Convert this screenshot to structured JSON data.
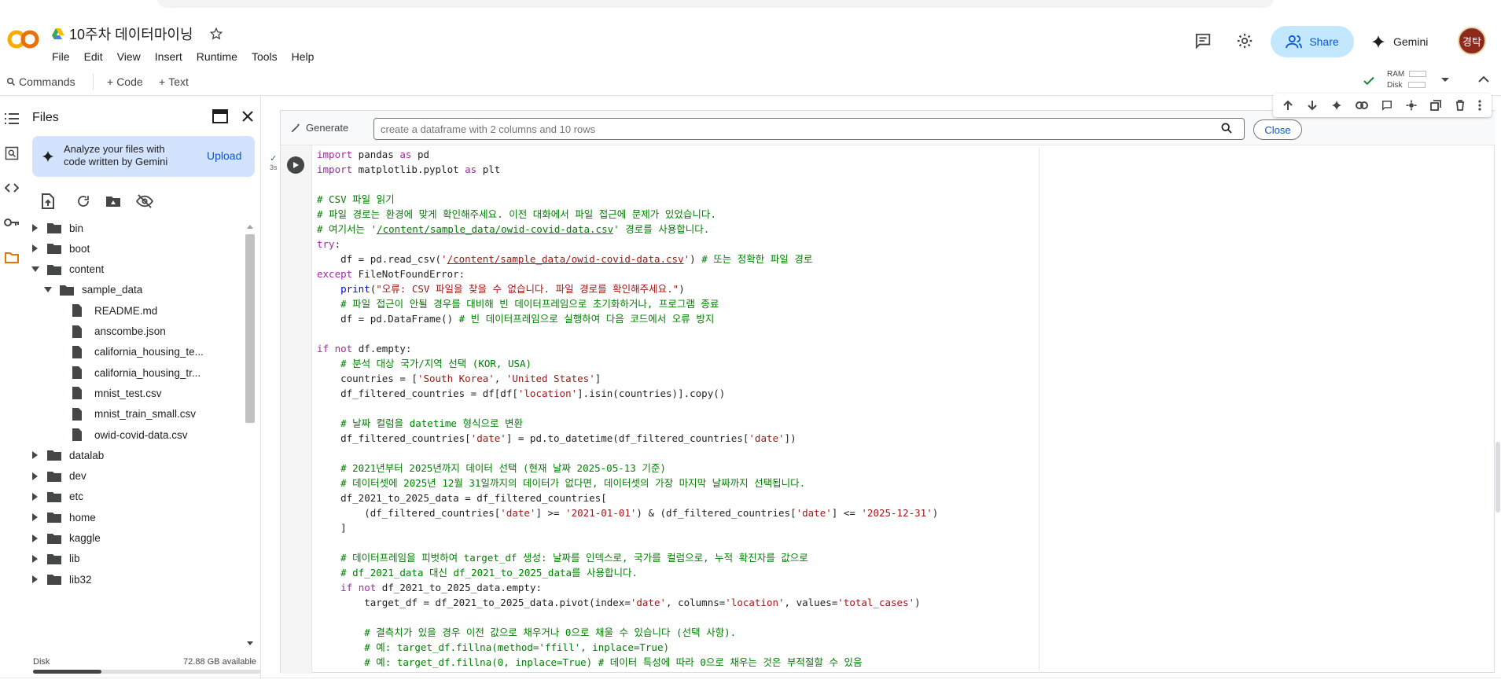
{
  "header": {
    "notebook_title": "10주차 데이터마이닝",
    "menu": [
      "File",
      "Edit",
      "View",
      "Insert",
      "Runtime",
      "Tools",
      "Help"
    ],
    "share_label": "Share",
    "gemini_label": "Gemini",
    "avatar_text": "경탁",
    "icons": [
      "comment-icon",
      "gear-icon",
      "share-people-icon",
      "sparkle-icon",
      "star-icon",
      "drive-icon"
    ]
  },
  "toolbar": {
    "commands_label": "Commands",
    "code_label": "Code",
    "text_label": "Text",
    "ram_label": "RAM",
    "disk_label": "Disk"
  },
  "files_panel": {
    "title": "Files",
    "analyze_text": "Analyze your files with code written by Gemini",
    "upload_label": "Upload",
    "tree": [
      {
        "name": "bin",
        "type": "folder",
        "depth": 0,
        "expanded": false
      },
      {
        "name": "boot",
        "type": "folder",
        "depth": 0,
        "expanded": false
      },
      {
        "name": "content",
        "type": "folder",
        "depth": 0,
        "expanded": true
      },
      {
        "name": "sample_data",
        "type": "folder",
        "depth": 1,
        "expanded": true
      },
      {
        "name": "README.md",
        "type": "file",
        "depth": 2
      },
      {
        "name": "anscombe.json",
        "type": "file",
        "depth": 2
      },
      {
        "name": "california_housing_te...",
        "type": "file",
        "depth": 2
      },
      {
        "name": "california_housing_tr...",
        "type": "file",
        "depth": 2
      },
      {
        "name": "mnist_test.csv",
        "type": "file",
        "depth": 2
      },
      {
        "name": "mnist_train_small.csv",
        "type": "file",
        "depth": 2
      },
      {
        "name": "owid-covid-data.csv",
        "type": "file",
        "depth": 2
      },
      {
        "name": "datalab",
        "type": "folder",
        "depth": 0,
        "expanded": false
      },
      {
        "name": "dev",
        "type": "folder",
        "depth": 0,
        "expanded": false
      },
      {
        "name": "etc",
        "type": "folder",
        "depth": 0,
        "expanded": false
      },
      {
        "name": "home",
        "type": "folder",
        "depth": 0,
        "expanded": false
      },
      {
        "name": "kaggle",
        "type": "folder",
        "depth": 0,
        "expanded": false
      },
      {
        "name": "lib",
        "type": "folder",
        "depth": 0,
        "expanded": false
      },
      {
        "name": "lib32",
        "type": "folder",
        "depth": 0,
        "expanded": false
      }
    ],
    "disk_label": "Disk",
    "disk_available": "72.88 GB available",
    "disk_used_fraction": 0.3
  },
  "cell": {
    "generate_label": "Generate",
    "generate_placeholder": "create a dataframe with 2 columns and 10 rows",
    "close_label": "Close",
    "exec_check": "✓",
    "exec_time": "3s",
    "code_lines": [
      [
        {
          "t": "import",
          "c": "kw"
        },
        {
          "t": " pandas "
        },
        {
          "t": "as",
          "c": "kw"
        },
        {
          "t": " pd"
        }
      ],
      [
        {
          "t": "import",
          "c": "kw"
        },
        {
          "t": " matplotlib.pyplot "
        },
        {
          "t": "as",
          "c": "kw"
        },
        {
          "t": " plt"
        }
      ],
      [],
      [
        {
          "t": "# CSV 파일 읽기",
          "c": "cm"
        }
      ],
      [
        {
          "t": "# 파일 경로는 환경에 맞게 확인해주세요. 이전 대화에서 파일 접근에 문제가 있었습니다.",
          "c": "cm"
        }
      ],
      [
        {
          "t": "# 여기서는 '",
          "c": "cm"
        },
        {
          "t": "/content/sample_data/owid-covid-data.csv",
          "c": "cm lk"
        },
        {
          "t": "' 경로를 사용합니다.",
          "c": "cm"
        }
      ],
      [
        {
          "t": "try",
          "c": "kw"
        },
        {
          "t": ":"
        }
      ],
      [
        {
          "t": "    df = pd.read_csv("
        },
        {
          "t": "'",
          "c": "st"
        },
        {
          "t": "/content/sample_data/owid-covid-data.csv",
          "c": "st lk"
        },
        {
          "t": "'",
          "c": "st"
        },
        {
          "t": ") "
        },
        {
          "t": "# 또는 정확한 파일 경로",
          "c": "cm"
        }
      ],
      [
        {
          "t": "except",
          "c": "kw"
        },
        {
          "t": " FileNotFoundError:"
        }
      ],
      [
        {
          "t": "    "
        },
        {
          "t": "print",
          "c": "kw2"
        },
        {
          "t": "("
        },
        {
          "t": "\"오류: CSV 파일을 찾을 수 없습니다. 파일 경로를 확인해주세요.\"",
          "c": "st"
        },
        {
          "t": ")"
        }
      ],
      [
        {
          "t": "    "
        },
        {
          "t": "# 파일 접근이 안될 경우를 대비해 빈 데이터프레임으로 초기화하거나, 프로그램 종료",
          "c": "cm"
        }
      ],
      [
        {
          "t": "    df = pd.DataFrame() "
        },
        {
          "t": "# 빈 데이터프레임으로 실행하여 다음 코드에서 오류 방지",
          "c": "cm"
        }
      ],
      [],
      [
        {
          "t": "if",
          "c": "kw"
        },
        {
          "t": " "
        },
        {
          "t": "not",
          "c": "kw"
        },
        {
          "t": " df.empty:"
        }
      ],
      [
        {
          "t": "    "
        },
        {
          "t": "# 분석 대상 국가/지역 선택 (KOR, USA)",
          "c": "cm"
        }
      ],
      [
        {
          "t": "    countries = ["
        },
        {
          "t": "'South Korea'",
          "c": "st"
        },
        {
          "t": ", "
        },
        {
          "t": "'United States'",
          "c": "st"
        },
        {
          "t": "]"
        }
      ],
      [
        {
          "t": "    df_filtered_countries = df[df["
        },
        {
          "t": "'location'",
          "c": "st"
        },
        {
          "t": "].isin(countries)].copy()"
        }
      ],
      [],
      [
        {
          "t": "    "
        },
        {
          "t": "# 날짜 컬럼을 datetime 형식으로 변환",
          "c": "cm"
        }
      ],
      [
        {
          "t": "    df_filtered_countries["
        },
        {
          "t": "'date'",
          "c": "st"
        },
        {
          "t": "] = pd.to_datetime(df_filtered_countries["
        },
        {
          "t": "'date'",
          "c": "st"
        },
        {
          "t": "])"
        }
      ],
      [],
      [
        {
          "t": "    "
        },
        {
          "t": "# 2021년부터 2025년까지 데이터 선택 (현재 날짜 2025-05-13 기준)",
          "c": "cm"
        }
      ],
      [
        {
          "t": "    "
        },
        {
          "t": "# 데이터셋에 2025년 12월 31일까지의 데이터가 없다면, 데이터셋의 가장 마지막 날짜까지 선택됩니다.",
          "c": "cm"
        }
      ],
      [
        {
          "t": "    df_2021_to_2025_data = df_filtered_countries["
        }
      ],
      [
        {
          "t": "        (df_filtered_countries["
        },
        {
          "t": "'date'",
          "c": "st"
        },
        {
          "t": "] >= "
        },
        {
          "t": "'2021-01-01'",
          "c": "st"
        },
        {
          "t": ") & (df_filtered_countries["
        },
        {
          "t": "'date'",
          "c": "st"
        },
        {
          "t": "] <= "
        },
        {
          "t": "'2025-12-31'",
          "c": "st"
        },
        {
          "t": ")"
        }
      ],
      [
        {
          "t": "    ]"
        }
      ],
      [],
      [
        {
          "t": "    "
        },
        {
          "t": "# 데이터프레임을 피벗하여 target_df 생성: 날짜를 인덱스로, 국가를 컬럼으로, 누적 확진자를 값으로",
          "c": "cm"
        }
      ],
      [
        {
          "t": "    "
        },
        {
          "t": "# df_2021_data 대신 df_2021_to_2025_data를 사용합니다.",
          "c": "cm"
        }
      ],
      [
        {
          "t": "    "
        },
        {
          "t": "if",
          "c": "kw"
        },
        {
          "t": " "
        },
        {
          "t": "not",
          "c": "kw"
        },
        {
          "t": " df_2021_to_2025_data.empty:"
        }
      ],
      [
        {
          "t": "        target_df = df_2021_to_2025_data.pivot(index="
        },
        {
          "t": "'date'",
          "c": "st"
        },
        {
          "t": ", columns="
        },
        {
          "t": "'location'",
          "c": "st"
        },
        {
          "t": ", values="
        },
        {
          "t": "'total_cases'",
          "c": "st"
        },
        {
          "t": ")"
        }
      ],
      [],
      [
        {
          "t": "        "
        },
        {
          "t": "# 결측치가 있을 경우 이전 값으로 채우거나 0으로 채울 수 있습니다 (선택 사항).",
          "c": "cm"
        }
      ],
      [
        {
          "t": "        "
        },
        {
          "t": "# 예: target_df.fillna(method='ffill', inplace=True)",
          "c": "cm"
        }
      ],
      [
        {
          "t": "        "
        },
        {
          "t": "# 예: target_df.fillna(0, inplace=True) # 데이터 특성에 따라 0으로 채우는 것은 부적절할 수 있음",
          "c": "cm"
        }
      ]
    ]
  },
  "colors": {
    "share_bg": "#c2e7ff",
    "accent_blue": "#0b57d0",
    "analyze_bg": "#d3e3fd",
    "logo_orange": "#f9ab00",
    "folder_color": "#444746"
  }
}
